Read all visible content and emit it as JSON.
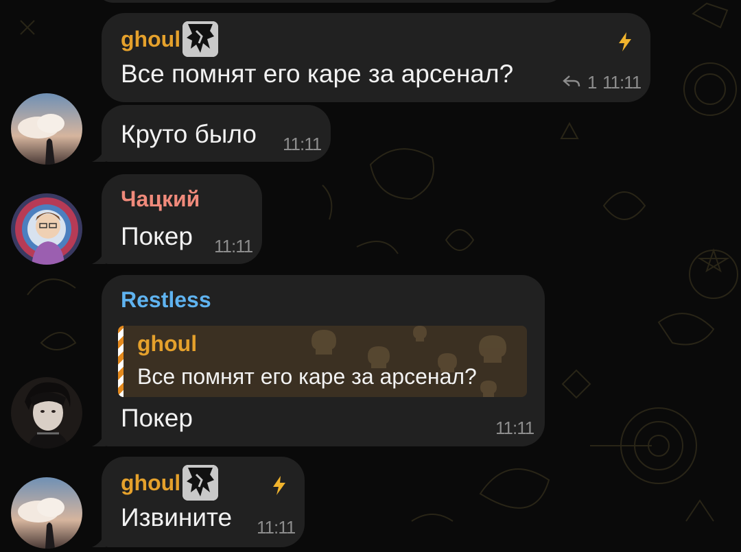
{
  "colors": {
    "bubble": "#212121",
    "name_ghoul": "#e5a12c",
    "name_chatsky": "#f08a7b",
    "name_restless": "#5fb3f0",
    "time": "#8d8d8d",
    "reply_accent": "#e48a1e"
  },
  "messages": [
    {
      "sender": "ghoul",
      "text": "Все помнят его каре за арсенал?",
      "replies_count": "1",
      "time": "11:11",
      "icons": [
        "sender-badge-icon",
        "lightning-icon",
        "reply-count-icon"
      ]
    },
    {
      "text": "Круто было",
      "time": "11:11"
    },
    {
      "sender": "Чацкий",
      "text": "Покер",
      "time": "11:11"
    },
    {
      "sender": "Restless",
      "quote": {
        "sender": "ghoul",
        "text": "Все помнят его каре за арсенал?"
      },
      "text": "Покер",
      "time": "11:11"
    },
    {
      "sender": "ghoul",
      "text": "Извините",
      "time": "11:11",
      "icons": [
        "sender-badge-icon",
        "lightning-icon"
      ]
    }
  ]
}
